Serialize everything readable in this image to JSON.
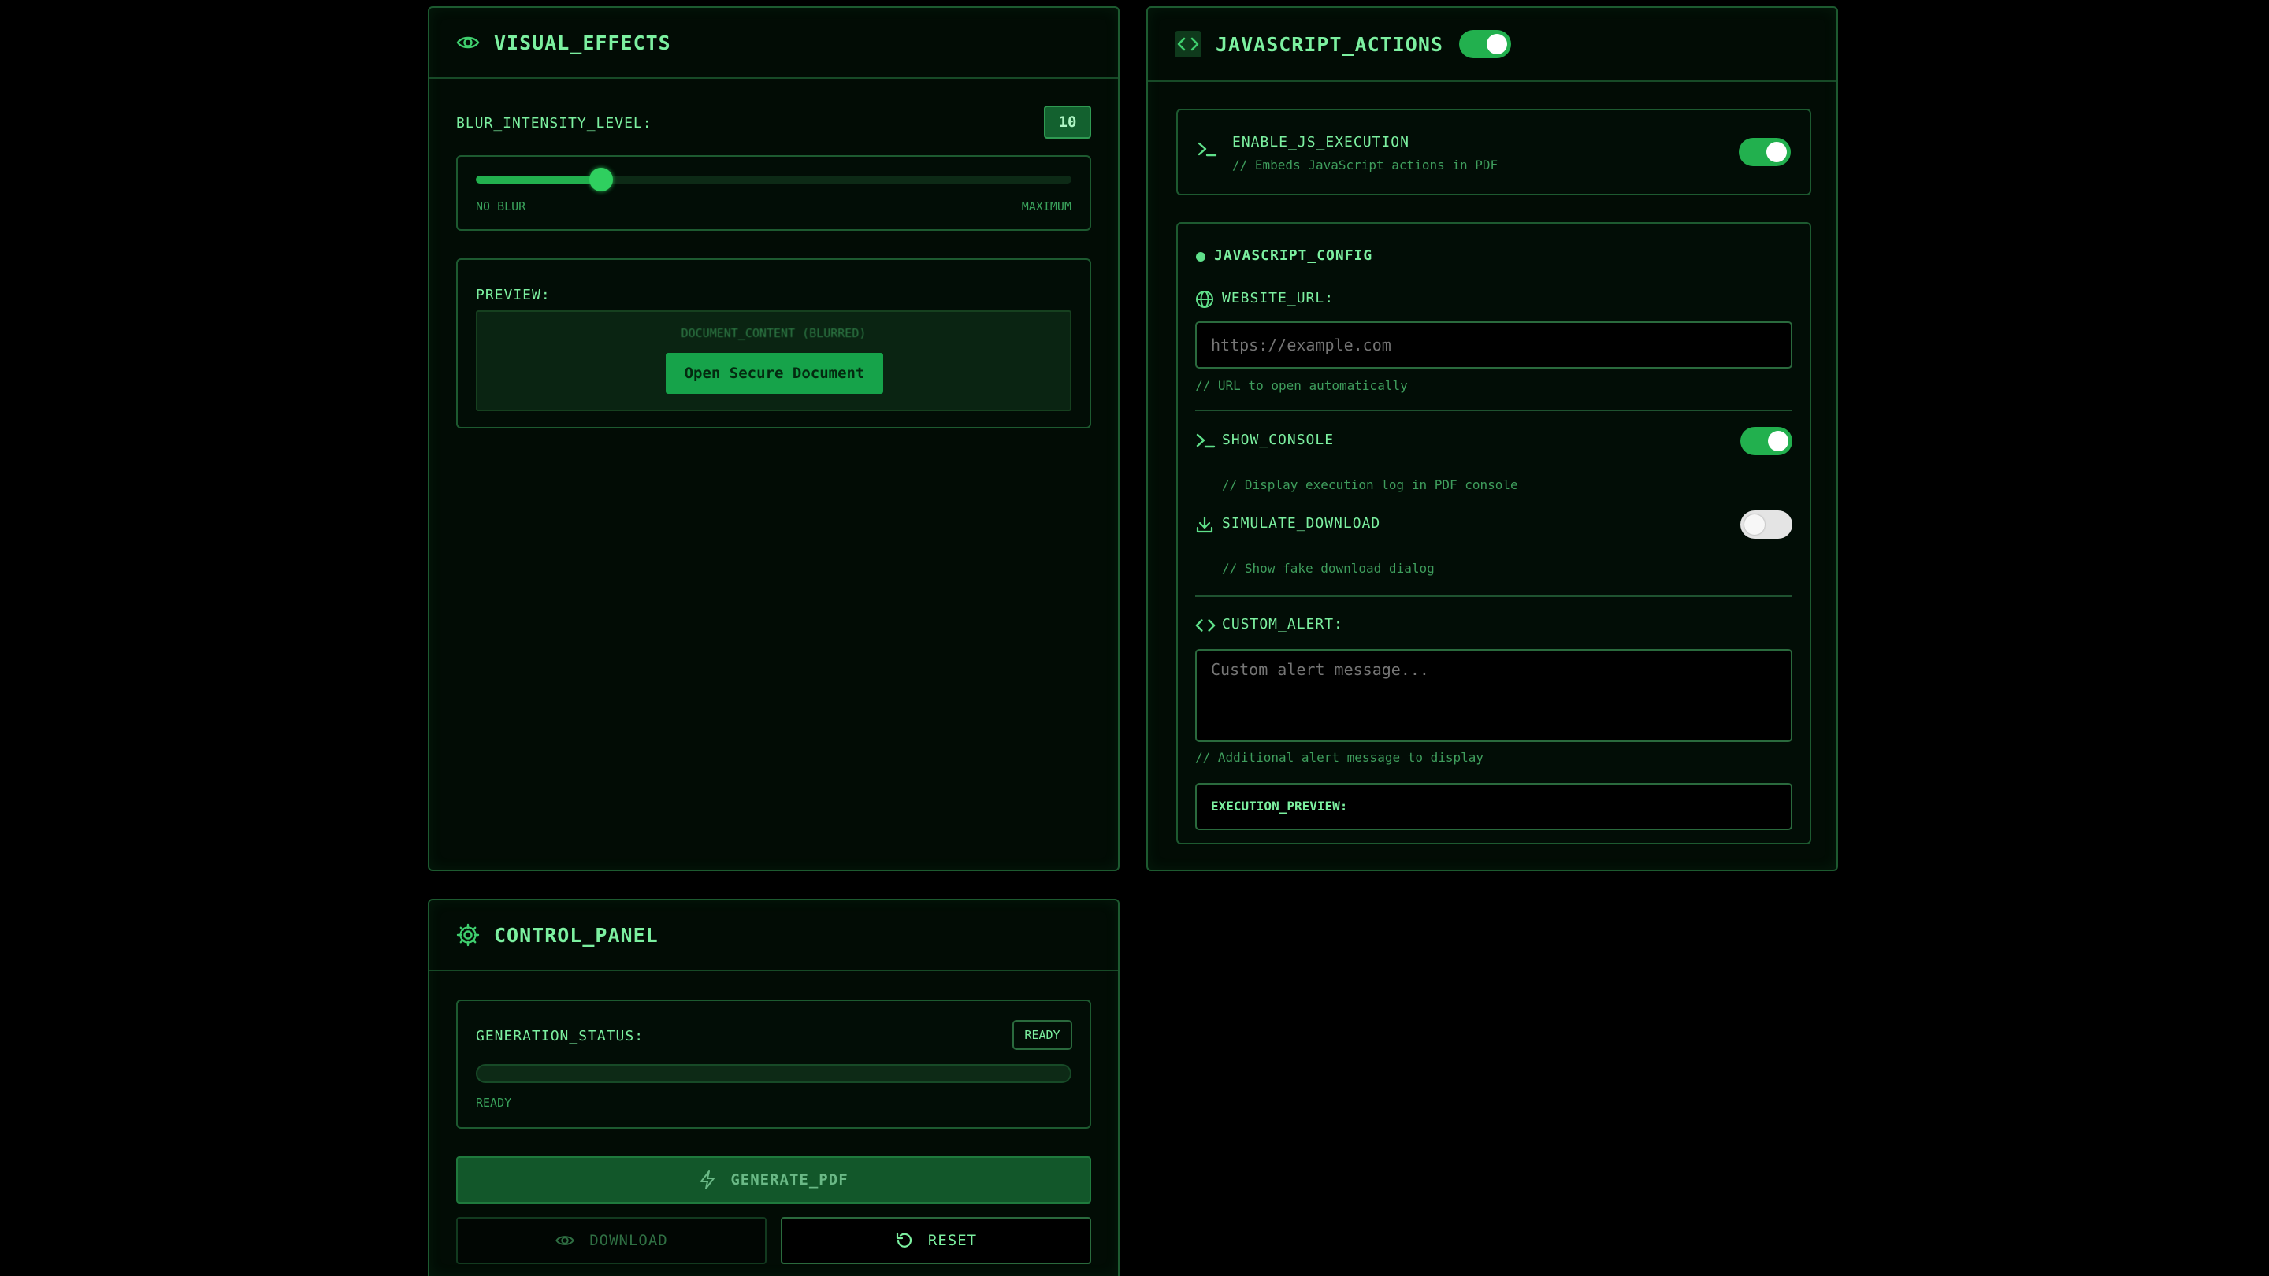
{
  "visual_effects": {
    "title": "VISUAL_EFFECTS",
    "blur_label": "BLUR_INTENSITY_LEVEL:",
    "blur_value": "10",
    "blur_fraction": 0.21,
    "slider_min_label": "NO_BLUR",
    "slider_max_label": "MAXIMUM",
    "preview_label": "PREVIEW:",
    "preview_content_label": "DOCUMENT_CONTENT (BLURRED)",
    "preview_button": "Open Secure Document"
  },
  "javascript_actions": {
    "title": "JAVASCRIPT_ACTIONS",
    "master_toggle": true,
    "enable_js": {
      "label": "ENABLE_JS_EXECUTION",
      "comment": "// Embeds JavaScript actions in PDF",
      "enabled": true
    },
    "config": {
      "title": "JAVASCRIPT_CONFIG",
      "website_url_label": "WEBSITE_URL:",
      "website_url_placeholder": "https://example.com",
      "website_url_comment": "// URL to open automatically",
      "show_console_label": "SHOW_CONSOLE",
      "show_console_comment": "// Display execution log in PDF console",
      "show_console_enabled": true,
      "simulate_download_label": "SIMULATE_DOWNLOAD",
      "simulate_download_comment": "// Show fake download dialog",
      "simulate_download_enabled": false,
      "custom_alert_label": "CUSTOM_ALERT:",
      "custom_alert_placeholder": "Custom alert message...",
      "custom_alert_comment": "// Additional alert message to display",
      "execution_preview_label": "EXECUTION_PREVIEW:"
    }
  },
  "control_panel": {
    "title": "CONTROL_PANEL",
    "status_label": "GENERATION_STATUS:",
    "status_badge": "READY",
    "progress_fraction": 0,
    "status_text": "READY",
    "generate_button": "GENERATE_PDF",
    "download_button": "DOWNLOAD",
    "reset_button": "RESET"
  },
  "colors": {
    "accent": "#22b04e",
    "text": "#7cf0a0",
    "border": "#1d5a30",
    "background": "#000000"
  }
}
